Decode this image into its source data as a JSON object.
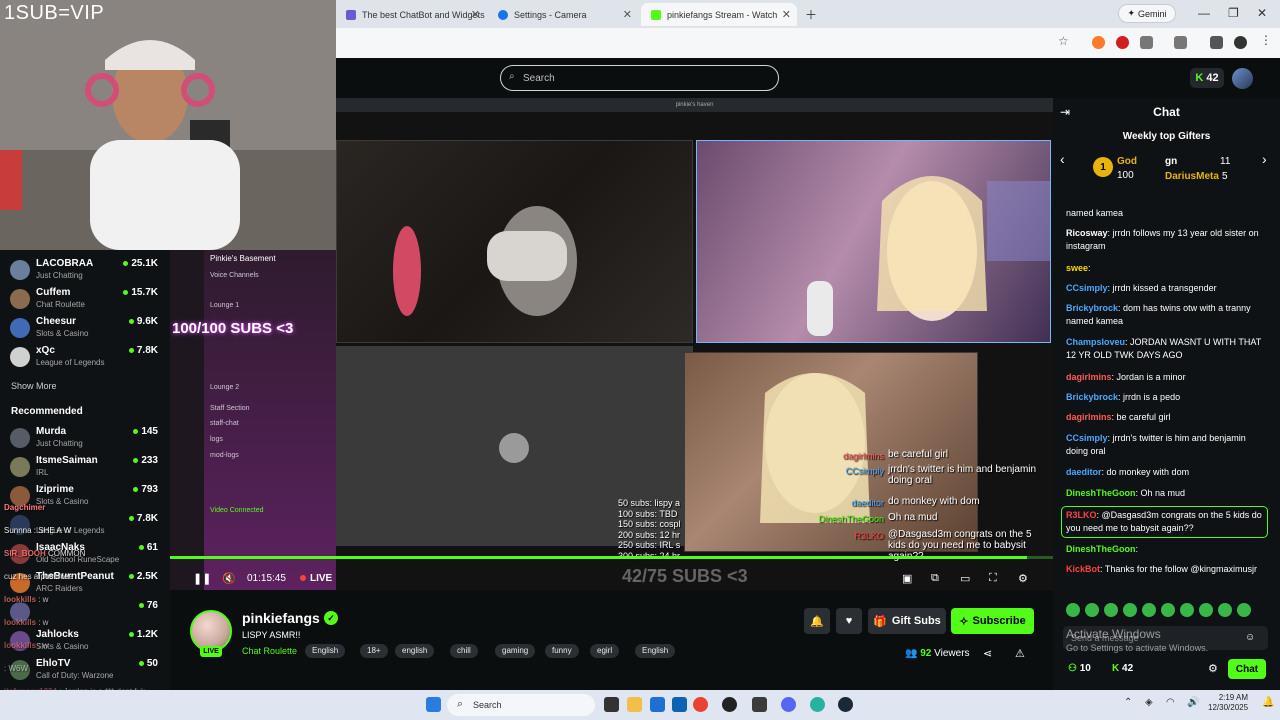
{
  "webcam": {
    "overlay_text": "1SUB=VIP"
  },
  "browser": {
    "tabs": [
      {
        "title": "The best ChatBot and Widgets"
      },
      {
        "title": "Settings - Camera"
      },
      {
        "title": "pinkiefangs Stream - Watch"
      }
    ],
    "gemini_label": "Gemini"
  },
  "kick": {
    "search_placeholder": "Search",
    "kicks_balance": "42"
  },
  "sidebar": {
    "following": [
      {
        "name": "LACOBRAA",
        "category": "Just Chatting",
        "viewers": "25.1K",
        "color": "#6b7f9c"
      },
      {
        "name": "Cuffem",
        "category": "Chat Roulette",
        "viewers": "15.7K",
        "color": "#8b6b50"
      },
      {
        "name": "Cheesur",
        "category": "Slots & Casino",
        "viewers": "9.6K",
        "color": "#3f6bb5"
      },
      {
        "name": "xQc",
        "category": "League of Legends",
        "viewers": "7.8K",
        "color": "#d0d0d0"
      }
    ],
    "show_more": "Show More",
    "recommended_title": "Recommended",
    "recommended": [
      {
        "name": "Murda",
        "category": "Just Chatting",
        "viewers": "145",
        "color": "#555c66"
      },
      {
        "name": "ItsmeSaiman",
        "category": "IRL",
        "viewers": "233",
        "color": "#7a7a5a"
      },
      {
        "name": "Iziprime",
        "category": "Slots & Casino",
        "viewers": "793",
        "color": "#8a5a3a"
      },
      {
        "name": "",
        "category": "League of Legends",
        "viewers": "7.8K",
        "color": "#2b3a58"
      },
      {
        "name": "IsaacNaks",
        "category": "Old School RuneScape",
        "viewers": "61",
        "color": "#8a3a3a"
      },
      {
        "name": "TheBurntPeanut",
        "category": "ARC Raiders",
        "viewers": "2.5K",
        "color": "#c76a2a"
      },
      {
        "name": "",
        "category": "",
        "viewers": "76",
        "color": "#5a5a8a"
      },
      {
        "name": "Jahlocks",
        "category": "Slots & Casino",
        "viewers": "1.2K",
        "color": "#6a4a8a"
      },
      {
        "name": "EhloTV",
        "category": "Call of Duty: Warzone",
        "viewers": "50",
        "color": "#4a6a4a"
      }
    ]
  },
  "overlay_chat": [
    {
      "user": "Dagchimer",
      "text": ""
    },
    {
      "user": "",
      "text": "Sunnna : SHE A W"
    },
    {
      "user": "SIR_BOOH",
      "text": "COMMON"
    },
    {
      "user": "",
      "text": "cuz hes a pushhiee"
    },
    {
      "user": "lookkills",
      "text": ": w"
    },
    {
      "user": "lookkills",
      "text": ": w"
    },
    {
      "user": "lookkills",
      "text": ": w"
    },
    {
      "user": "",
      "text": ": W6W"
    },
    {
      "user": "itsfunsey1234",
      "text": ": Jordan is a *** dont fuk"
    }
  ],
  "discord": {
    "banner": "100/100 SUBS <3",
    "server": "Pinkie's Basement",
    "channels": [
      "Voice Channels",
      "Lounge 1",
      "Lounge 2",
      "Staff Section",
      "staff-chat",
      "logs",
      "mod-logs"
    ],
    "status": "Video Connected"
  },
  "video": {
    "window_title": "pinkie's haven",
    "overlay_chat": [
      {
        "user": "dagirlmins",
        "text": "be careful girl",
        "color": "#ff5a5a"
      },
      {
        "user": "CCsimply",
        "text": "jrrdn's twitter is him and benjamin doing oral",
        "color": "#4aa8ff"
      },
      {
        "user": "daeditor",
        "text": "do monkey with dom",
        "color": "#4aa8ff"
      },
      {
        "user": "DineshTheGoon",
        "text": "Oh na mud",
        "color": "#53fc18"
      },
      {
        "user": "R3LKO",
        "text": "@Dasgasd3m congrats on the 5 kids do you need me to babysit again??",
        "color": "#ff4040"
      }
    ],
    "sub_goals": [
      "50 subs: lispy a",
      "100 subs: TBD",
      "150 subs: cospl",
      "200 subs: 12 hr",
      "250 subs: IRL s",
      "300 subs: 24 hr"
    ],
    "subs_banner": "42/75 SUBS <3",
    "progress": 0.97,
    "time": "01:15:45",
    "live_label": "LIVE"
  },
  "stream": {
    "streamer": "pinkiefangs",
    "title": "LISPY ASMR!!",
    "category": "Chat Roulette",
    "tags": [
      "English",
      "18+",
      "english",
      "chill",
      "gaming",
      "funny",
      "egirl",
      "English"
    ],
    "live_badge": "LIVE",
    "gift_subs_label": "Gift Subs",
    "subscribe_label": "Subscribe",
    "viewers": "92",
    "viewers_label": "Viewers"
  },
  "chat": {
    "title": "Chat",
    "weekly_title": "Weekly top Gifters",
    "gifters": [
      {
        "name": "God",
        "count": "100"
      },
      {
        "name": "gn",
        "count": "11"
      },
      {
        "name": "DariusMeta",
        "count": "5"
      }
    ],
    "messages": [
      {
        "user": "",
        "text": "named kamea",
        "color": "#ffffff"
      },
      {
        "user": "Ricosway",
        "text": "jrrdn follows my 13 year old sister on instagram",
        "color": "#ffffff"
      },
      {
        "user": "swee",
        "text": "",
        "color": "#ffd700"
      },
      {
        "user": "CCsimply",
        "text": "jrrdn kissed a transgender",
        "color": "#4aa8ff"
      },
      {
        "user": "Brickybrock",
        "text": "dom has twins otw with a tranny named kamea",
        "color": "#4aa8ff"
      },
      {
        "user": "Champsloveu",
        "text": "JORDAN WASNT U WITH THAT 12 YR OLD TWK DAYS AGO",
        "color": "#4aa8ff"
      },
      {
        "user": "dagirlmins",
        "text": "Jordan is a minor",
        "color": "#ff5a5a"
      },
      {
        "user": "Brickybrock",
        "text": "jrrdn is a pedo",
        "color": "#4aa8ff"
      },
      {
        "user": "dagirlmins",
        "text": "be careful girl",
        "color": "#ff5a5a"
      },
      {
        "user": "CCsimply",
        "text": "jrrdn's twitter is him and benjamin doing oral",
        "color": "#4aa8ff"
      },
      {
        "user": "daeditor",
        "text": "do monkey with dom",
        "color": "#4aa8ff"
      },
      {
        "user": "DineshTheGoon",
        "text": "Oh na mud",
        "color": "#53fc18"
      },
      {
        "user": "R3LKO",
        "text": "@Dasgasd3m congrats on the 5 kids do you need me to babysit again??",
        "color": "#ff4040"
      },
      {
        "user": "DineshTheGoon",
        "text": "",
        "color": "#53fc18"
      },
      {
        "user": "KickBot",
        "text": "Thanks for the follow @kingmaximusjr",
        "color": "#ff4040"
      }
    ],
    "input_placeholder": "Send a message",
    "points": "10",
    "kicks": "42",
    "send_label": "Chat",
    "activate_title": "Activate Windows",
    "activate_sub": "Go to Settings to activate Windows."
  },
  "taskbar": {
    "search": "Search",
    "time": "2:19 AM",
    "date": "12/30/2025"
  },
  "colors": {
    "kick_green": "#53fc18",
    "bg": "#0b0e0f"
  }
}
